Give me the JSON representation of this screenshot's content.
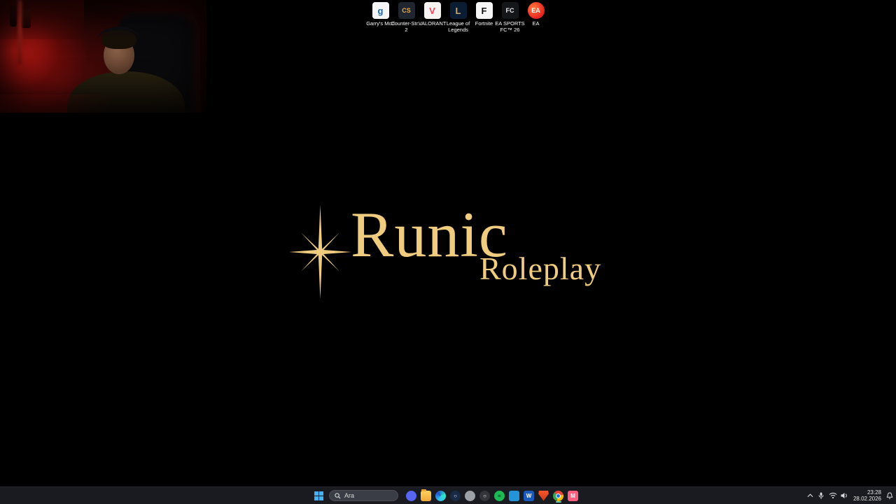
{
  "webcam": {
    "name": "facecam-overlay"
  },
  "desktop_icons": [
    {
      "id": "garrys-mod",
      "label": "Garry's Mod",
      "glyph": "g",
      "bg": "#f4f6f8",
      "glyph_color": "#1668b4"
    },
    {
      "id": "counter-strike-2",
      "label": "Counter-Str...\n2",
      "glyph": "CS",
      "bg": "#1f2630",
      "glyph_color": "#f0a93c"
    },
    {
      "id": "valorant",
      "label": "VALORANT",
      "glyph": "V",
      "bg": "#f7f3f3",
      "glyph_color": "#fa4454"
    },
    {
      "id": "league-of-legends",
      "label": "League of\nLegends",
      "glyph": "L",
      "bg": "#0b1d33",
      "glyph_color": "#c8aa6e"
    },
    {
      "id": "fortnite",
      "label": "Fortnite",
      "glyph": "F",
      "bg": "#f5f5f5",
      "glyph_color": "#111111"
    },
    {
      "id": "ea-sports-fc-26",
      "label": "EA SPORTS\nFC™ 26",
      "glyph": "FC",
      "bg": "#15161a",
      "glyph_color": "#e8e8e8"
    },
    {
      "id": "ea",
      "label": "EA",
      "glyph": "EA",
      "bg": "radial-gradient(circle at 35% 35%, #ff7a3c, #e8231f 70%)",
      "glyph_color": "#ffffff",
      "shape": "circle"
    }
  ],
  "logo": {
    "title": "Runic",
    "subtitle": "Roleplay",
    "color": "#f0cd7e"
  },
  "taskbar": {
    "search_placeholder": "Ara",
    "app_icons": [
      {
        "id": "discord",
        "bg": "#5865f2",
        "shape": "circle"
      },
      {
        "id": "file-explorer",
        "bg": "linear-gradient(#ffd35c,#f2a93b)",
        "shape": "rounded"
      },
      {
        "id": "edge",
        "bg": "conic-gradient(from 200deg,#35c1f1,#2052cb,#30e6c6,#35c1f1)",
        "shape": "circle"
      },
      {
        "id": "steam",
        "bg": "#182a45",
        "shape": "circle",
        "glyph": "○",
        "glyph_color": "#dfe6ee"
      },
      {
        "id": "parsec",
        "bg": "#9aa0a6",
        "shape": "circle"
      },
      {
        "id": "obs",
        "bg": "#33343a",
        "shape": "circle",
        "glyph": "○",
        "glyph_color": "#ffffff"
      },
      {
        "id": "spotify",
        "bg": "#1db954",
        "shape": "circle",
        "glyph": "≈",
        "glyph_color": "#0d3a21"
      },
      {
        "id": "vscode",
        "bg": "#2494d8",
        "shape": "rounded"
      },
      {
        "id": "word",
        "bg": "#185abd",
        "shape": "rounded",
        "glyph": "W",
        "glyph_color": "#ffffff"
      },
      {
        "id": "brave",
        "bg": "linear-gradient(#fb542b,#c43a17)",
        "shape": "shield"
      },
      {
        "id": "chrome",
        "style": "chrome",
        "shape": "circle",
        "active": true
      },
      {
        "id": "medal",
        "bg": "#ff5f7e",
        "shape": "rounded",
        "glyph": "M",
        "glyph_color": "#ffffff"
      }
    ],
    "tray": {
      "time": "23:28",
      "date": "28.02.2026"
    }
  }
}
